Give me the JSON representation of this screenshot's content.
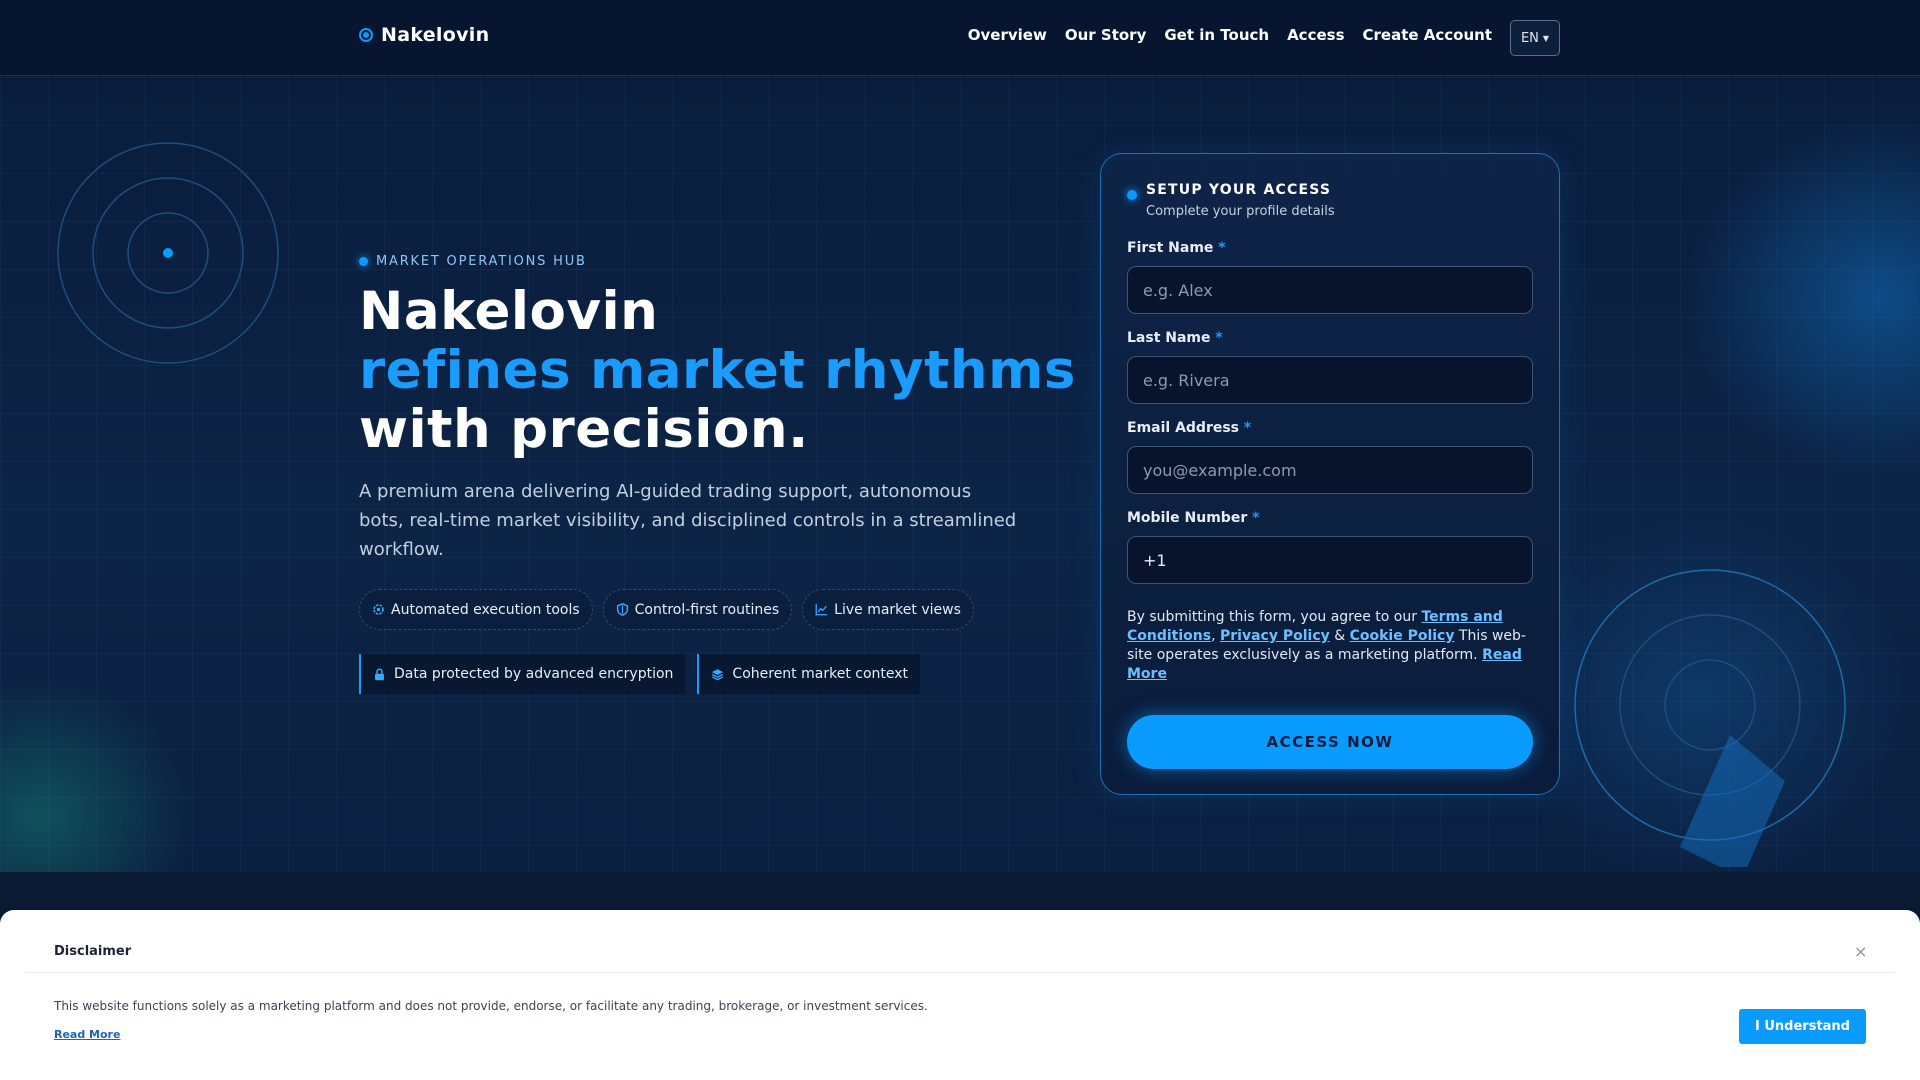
{
  "brand": {
    "name": "Nakelovin"
  },
  "nav": {
    "items": [
      "Overview",
      "Our Story",
      "Get in Touch",
      "Access",
      "Create Account"
    ],
    "language": "EN"
  },
  "hero": {
    "eyebrow": "MARKET OPERATIONS HUB",
    "headline_line1": "Nakelovin",
    "headline_line2": "refines market rhythms",
    "headline_line3": "with precision.",
    "subtext": "A premium arena delivering AI-guided trading support, autonomous bots, real-time market visibility, and disciplined controls in a streamlined workflow.",
    "pills": [
      {
        "label": "Automated execution tools",
        "icon": "cog-icon"
      },
      {
        "label": "Control-first routines",
        "icon": "shield-icon"
      },
      {
        "label": "Live market views",
        "icon": "chart-line-icon"
      }
    ],
    "trust": [
      {
        "label": "Data protected by advanced encryption",
        "icon": "lock-icon"
      },
      {
        "label": "Coherent market context",
        "icon": "layers-icon"
      }
    ]
  },
  "form": {
    "title": "SETUP YOUR ACCESS",
    "subtitle": "Complete your profile details",
    "first_name_label": "First Name",
    "first_name_placeholder": "e.g. Alex",
    "last_name_label": "Last Name",
    "last_name_placeholder": "e.g. Rivera",
    "email_label": "Email Address",
    "email_placeholder": "you@example.com",
    "phone_label": "Mobile Number",
    "phone_value": "+1",
    "required_mark": "*",
    "consent_prefix": "By submitting this form, you agree to our",
    "terms_link": "Terms and Conditions",
    "comma": ",",
    "privacy_link": "Privacy Policy",
    "amp": "&",
    "cookie_link": "Cookie Policy",
    "consent_suffix": "This web-site operates exclusively as a marketing platform.",
    "read_more_link": "Read More",
    "submit_label": "ACCESS NOW"
  },
  "disclaimer": {
    "title": "Disclaimer",
    "close": "×",
    "text": "This website functions solely as a marketing platform and does not provide, endorse, or facilitate any trading, brokerage, or investment services.",
    "read_more": "Read More",
    "button": "I Understand"
  },
  "colors": {
    "accent": "#0a9bff",
    "background": "#0a1d3c",
    "topbar": "#071530"
  }
}
